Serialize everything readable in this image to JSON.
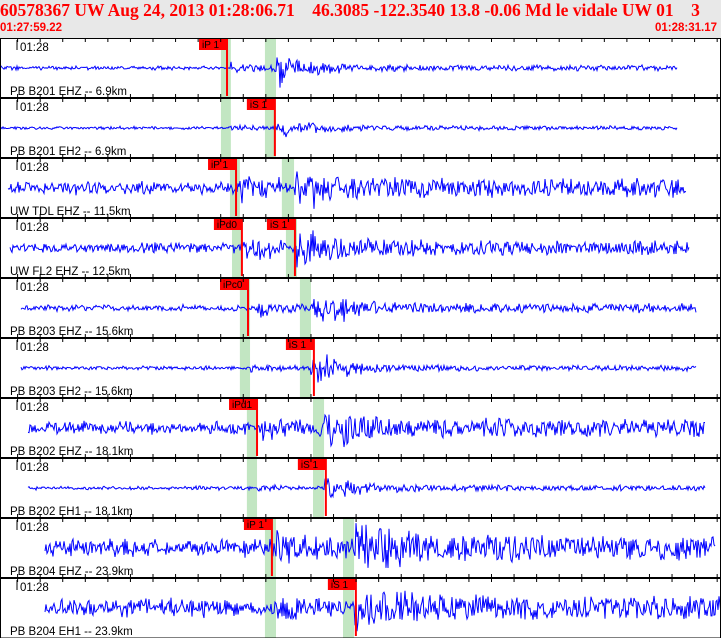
{
  "header": {
    "title": "60578367 UW Aug 24, 2013 01:28:06.71    46.3085 -122.3540 13.8 -0.06 Md le vidale UW 01    3",
    "start_time": "01:27:59.22",
    "end_time": "01:28:31.17"
  },
  "colors": {
    "trace": "#0000ff",
    "pick": "#ff0000",
    "window": "#c2e6c2",
    "header_text": "#ff0000",
    "header_bg": "#e8e8e8"
  },
  "panels": [
    {
      "time_label": "01:28",
      "station": "PB B201 EHZ -- 6.9km",
      "trace": [
        "01:27:59.22",
        "01:28:29.25"
      ],
      "p_window": [
        "01:28:09.01",
        "01:28:09.45"
      ],
      "s_window": [
        "01:28:10.96",
        "01:28:11.45"
      ],
      "picks": [
        {
          "label": "iP 1",
          "time": "01:28:09.28"
        }
      ]
    },
    {
      "time_label": "01:28",
      "station": "PB B201 EH2 -- 6.9km",
      "trace": [
        "01:27:59.22",
        "01:28:29.25"
      ],
      "p_window": [
        "01:28:09.01",
        "01:28:09.45"
      ],
      "s_window": [
        "01:28:10.96",
        "01:28:11.45"
      ],
      "picks": [
        {
          "label": "iS 1",
          "time": "01:28:11.40"
        }
      ]
    },
    {
      "time_label": "01:28",
      "station": "UW TDL EHZ -- 11.5km",
      "trace": [
        "01:27:59.57",
        "01:28:29.62"
      ],
      "p_window": [
        "01:28:09.41",
        "01:28:09.85"
      ],
      "s_window": [
        "01:28:11.71",
        "01:28:12.25"
      ],
      "picks": [
        {
          "label": "iP 1",
          "time": "01:28:09.68"
        }
      ]
    },
    {
      "time_label": "01:28",
      "station": "UW FL2 EHZ -- 12.5km",
      "trace": [
        "01:27:59.66",
        "01:28:29.79"
      ],
      "p_window": [
        "01:28:09.50",
        "01:28:09.94"
      ],
      "s_window": [
        "01:28:11.89",
        "01:28:12.38"
      ],
      "picks": [
        {
          "label": "iPd0",
          "time": "01:28:09.94"
        },
        {
          "label": "iS 1",
          "time": "01:28:12.29"
        }
      ]
    },
    {
      "time_label": "01:28",
      "station": "PB B203 EHZ -- 15.6km",
      "trace": [
        "01:28:00.11",
        "01:28:30.10"
      ],
      "p_window": [
        "01:28:09.85",
        "01:28:10.30"
      ],
      "s_window": [
        "01:28:12.51",
        "01:28:13.00"
      ],
      "picks": [
        {
          "label": "iPc0",
          "time": "01:28:10.21"
        }
      ]
    },
    {
      "time_label": "01:28",
      "station": "PB B203 EH2 -- 15.6km",
      "trace": [
        "01:28:00.11",
        "01:28:30.10"
      ],
      "p_window": [
        "01:28:09.85",
        "01:28:10.30"
      ],
      "s_window": [
        "01:28:12.51",
        "01:28:13.00"
      ],
      "picks": [
        {
          "label": "iS 1",
          "time": "01:28:13.13"
        }
      ]
    },
    {
      "time_label": "01:28",
      "station": "PB B202 EHZ -- 18.1km",
      "trace": [
        "01:28:00.42",
        "01:28:30.50"
      ],
      "p_window": [
        "01:28:10.16",
        "01:28:10.61"
      ],
      "s_window": [
        "01:28:13.09",
        "01:28:13.58"
      ],
      "picks": [
        {
          "label": "iPd1",
          "time": "01:28:10.61"
        }
      ]
    },
    {
      "time_label": "01:28",
      "station": "PB B202 EH1 -- 18.1km",
      "trace": [
        "01:28:00.42",
        "01:28:30.50"
      ],
      "p_window": [
        "01:28:10.16",
        "01:28:10.61"
      ],
      "s_window": [
        "01:28:13.09",
        "01:28:13.58"
      ],
      "picks": [
        {
          "label": "iS 1",
          "time": "01:28:13.66"
        }
      ]
    },
    {
      "time_label": "01:28",
      "station": "PB B204 EHZ -- 23.9km",
      "trace": [
        "01:28:01.17",
        "01:28:30.94"
      ],
      "p_window": [
        "01:28:10.96",
        "01:28:11.45"
      ],
      "s_window": [
        "01:28:14.42",
        "01:28:14.91"
      ],
      "picks": [
        {
          "label": "iP 1",
          "time": "01:28:11.27"
        }
      ]
    },
    {
      "time_label": "01:28",
      "station": "PB B204 EH1 -- 23.9km",
      "trace": [
        "01:28:01.17",
        "01:28:31.17"
      ],
      "p_window": [
        "01:28:10.96",
        "01:28:11.45"
      ],
      "s_window": [
        "01:28:14.42",
        "01:28:14.91"
      ],
      "picks": [
        {
          "label": "iS 1",
          "time": "01:28:14.99"
        }
      ]
    }
  ]
}
